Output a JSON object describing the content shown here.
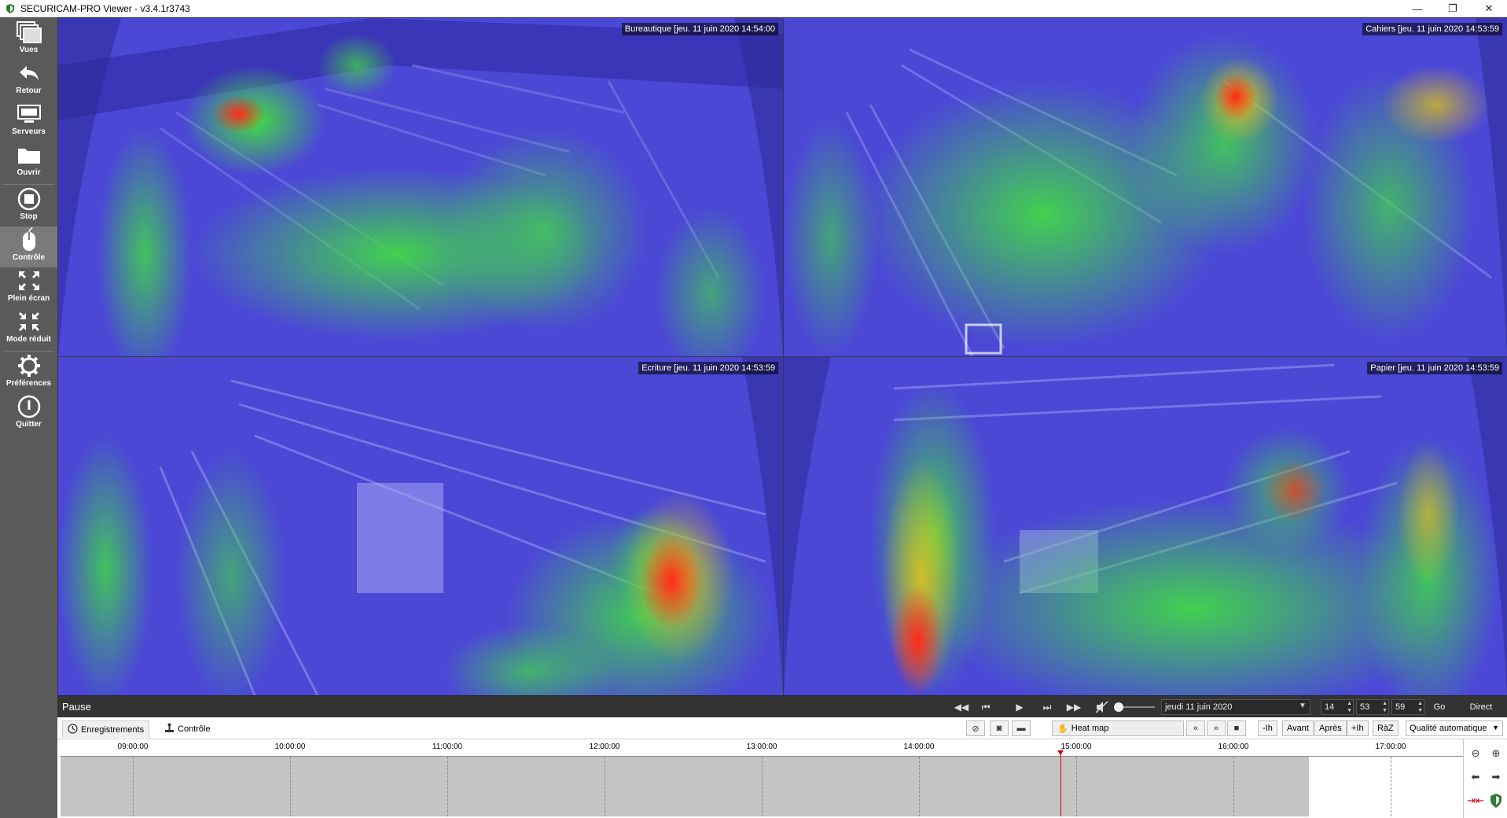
{
  "window": {
    "title": "SECURICAM-PRO Viewer - v3.4.1r3743",
    "minimize": "—",
    "restore": "❐",
    "close": "✕"
  },
  "sidebar": {
    "items": [
      {
        "label": "Vues",
        "icon": "views-icon"
      },
      {
        "label": "Retour",
        "icon": "back-arrow-icon"
      },
      {
        "label": "Serveurs",
        "icon": "servers-icon"
      },
      {
        "label": "Ouvrir",
        "icon": "folder-icon"
      },
      {
        "label": "Stop",
        "icon": "stop-icon"
      },
      {
        "label": "Contrôle",
        "icon": "mouse-icon"
      },
      {
        "label": "Plein écran",
        "icon": "fullscreen-icon"
      },
      {
        "label": "Mode réduit",
        "icon": "reduced-mode-icon"
      },
      {
        "label": "Préférences",
        "icon": "gear-icon"
      },
      {
        "label": "Quitter",
        "icon": "power-icon"
      }
    ]
  },
  "cameras": [
    {
      "label": "Bureautique [jeu. 11 juin 2020 14:54:00"
    },
    {
      "label": "Cahiers [jeu. 11 juin 2020 14:53:59"
    },
    {
      "label": "Ecriture [jeu. 11 juin 2020 14:53:59"
    },
    {
      "label": "Papier [jeu. 11 juin 2020 14:53:59"
    }
  ],
  "controls": {
    "status": "Pause",
    "date": "jeudi 11 juin 2020",
    "hour": "14",
    "minute": "53",
    "second": "59",
    "go": "Go",
    "live": "Direct",
    "volume_level": 0.0
  },
  "tabs": {
    "recordings": "Enregistrements",
    "control": "Contrôle",
    "heatmap": "Heat map",
    "minus_hour": "-Ih",
    "before": "Avant",
    "after": "Après",
    "plus_hour": "+Ih",
    "reset": "RàZ",
    "quality": "Qualité automatique"
  },
  "timeline": {
    "ticks": [
      "09:00:00",
      "10:00:00",
      "11:00:00",
      "12:00:00",
      "13:00:00",
      "14:00:00",
      "15:00:00",
      "16:00:00",
      "17:00:00"
    ],
    "cursor_time": "14:53:59"
  },
  "colors": {
    "heat_low": "#4a48e0",
    "heat_mid": "#3cd23c",
    "heat_high": "#e8281e",
    "timeline_cursor": "#d00000"
  }
}
